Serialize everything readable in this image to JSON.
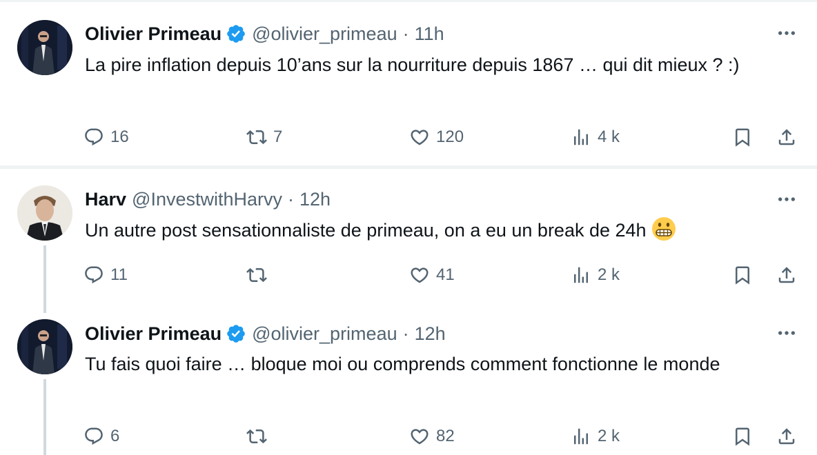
{
  "tweets": [
    {
      "name": "Olivier Primeau",
      "verified": true,
      "handle": "@olivier_primeau",
      "sep": "·",
      "time": "11h",
      "text": "La pire inflation depuis 10’ans  sur la nourriture depuis 1867 … qui dit mieux ? :)",
      "replies": "16",
      "reposts": "7",
      "likes": "120",
      "views": "4 k"
    },
    {
      "name": "Harv",
      "verified": false,
      "handle": "@InvestwithHarvy",
      "sep": "·",
      "time": "12h",
      "text": "Un autre post sensationnaliste de primeau, on a eu un break de 24h",
      "emoji": "grimacing-face-emoji",
      "replies": "11",
      "reposts": "",
      "likes": "41",
      "views": "2 k"
    },
    {
      "name": "Olivier Primeau",
      "verified": true,
      "handle": "@olivier_primeau",
      "sep": "·",
      "time": "12h",
      "text": "Tu fais quoi faire … bloque moi ou comprends comment fonctionne le monde",
      "replies": "6",
      "reposts": "",
      "likes": "82",
      "views": "2 k"
    }
  ],
  "colors": {
    "text": "#0f1419",
    "muted": "#536471",
    "verified": "#1d9bf0",
    "divider": "#eff3f4",
    "thread_line": "#cfd9de"
  },
  "icons": [
    "reply-icon",
    "repost-icon",
    "like-icon",
    "views-icon",
    "bookmark-icon",
    "share-icon",
    "more-icon",
    "verified-badge-icon"
  ]
}
